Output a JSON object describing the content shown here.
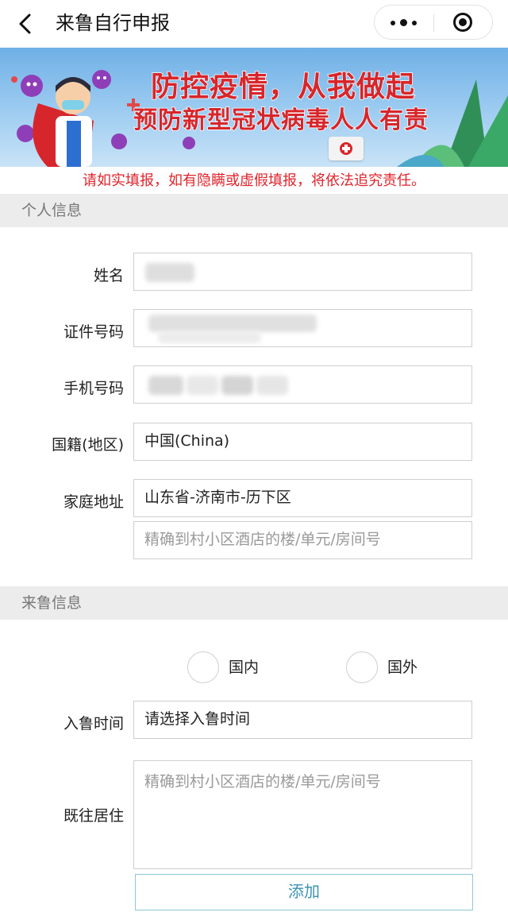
{
  "header": {
    "title": "来鲁自行申报",
    "back_icon": "chevron-left-icon",
    "more_icon": "more-dots-icon",
    "close_icon": "target-close-icon"
  },
  "banner": {
    "slogan_line1": "防控疫情，从我做起",
    "slogan_line2": "预防新型冠状病毒人人有责",
    "accent_color": "#d7262b"
  },
  "warning_text": "请如实填报，如有隐瞒或虚假填报，将依法追究责任。",
  "personal_section": {
    "title": "个人信息",
    "fields": [
      {
        "label": "姓名",
        "value": ""
      },
      {
        "label": "证件号码",
        "value": ""
      },
      {
        "label": "手机号码",
        "value": ""
      },
      {
        "label": "国籍(地区)",
        "value": "中国(China)"
      },
      {
        "label": "家庭地址",
        "value": "山东省-济南市-历下区"
      }
    ],
    "address_detail_placeholder": "精确到村小区酒店的楼/单元/房间号"
  },
  "arrival_section": {
    "title": "来鲁信息",
    "radio_options": [
      "国内",
      "国外"
    ],
    "arrival_time_label": "入鲁时间",
    "arrival_time_placeholder": "请选择入鲁时间",
    "past_residence_label": "既往居住",
    "past_residence_placeholder": "精确到村小区酒店的楼/单元/房间号",
    "add_button": "添加"
  }
}
